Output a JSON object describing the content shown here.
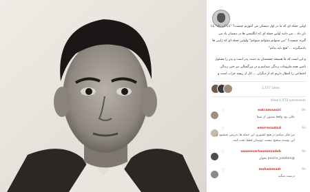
{
  "caption": {
    "line1": "اولین جمله ای که ما در اول دبستان می آموزیم چیست؟ \"بابا آب داد\" بابا نان داد… می دانید اولین جمله ای که انگلیسی ها در دبستان یاد می گیرند چیست؟ \"من میتوانم میتوانم میتوانم\" واولین جمله ای که ژاپنی ها یادمیگیرند …\"هیچ باید بدانم\"",
    "line2": "و این است که ما همیشه چشممان به دست پدر است و پدر را مسئول تامین همه ملزومات زندگی میدانیم و در بزرگسالی نیز حتی زندگی اجتماعی را انتظار داریم که از دیگران … کار از ریشه خراب است و"
  },
  "likes": {
    "text": "1,577 Likes"
  },
  "comments_link": "View 1,572 comments",
  "comments": [
    {
      "user": "eakramnasiri",
      "time": "6h",
      "text": "عالی بود واقعا ممنون از شما"
    },
    {
      "user": "amirrezaatnd",
      "time": "6h",
      "text": "من فکر میکنم در هیچ کشوری این جمله ها تدریس نمیشود و این نوشته صحیح نیست دوستان لطفا دقت کنید"
    },
    {
      "user": "uasemsarhassanzadeh",
      "time": "6h",
      "text": "@pouria_yazdani بخوان"
    },
    {
      "user": "mohammadr",
      "time": "6h",
      "text": "درست میگید"
    }
  ],
  "colors": {
    "username": "#c0392b",
    "muted": "#8e8e8e"
  }
}
